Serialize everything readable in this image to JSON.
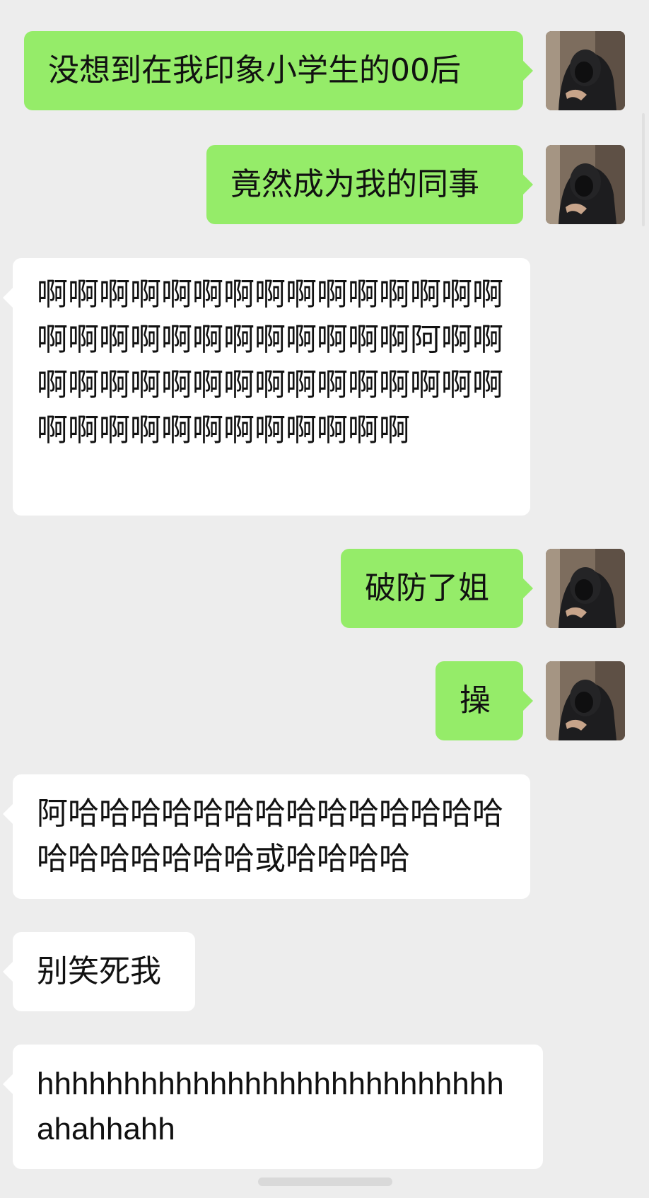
{
  "messages": [
    {
      "side": "sent",
      "text": "没想到在我印象小学生的00后"
    },
    {
      "side": "sent",
      "text": "竟然成为我的同事"
    },
    {
      "side": "recv",
      "text": "啊啊啊啊啊啊啊啊啊啊啊啊啊啊啊啊啊啊啊啊啊啊啊啊啊啊啊阿啊啊啊啊啊啊啊啊啊啊啊啊啊啊啊啊啊啊啊啊啊啊啊啊啊啊啊啊啊"
    },
    {
      "side": "sent",
      "text": "破防了姐"
    },
    {
      "side": "sent",
      "text": "操"
    },
    {
      "side": "recv",
      "text": "阿哈哈哈哈哈哈哈哈哈哈哈哈哈哈哈哈哈哈哈哈哈或哈哈哈哈"
    },
    {
      "side": "recv",
      "text": "别笑死我"
    },
    {
      "side": "recv",
      "text": "hhhhhhhhhhhhhhhhhhhhhhhhhhhahahhahh"
    }
  ],
  "colors": {
    "background": "#ededed",
    "sent_bubble": "#95ec69",
    "received_bubble": "#ffffff"
  },
  "icons": {
    "avatar": "avatar-hooded-person-photo"
  }
}
